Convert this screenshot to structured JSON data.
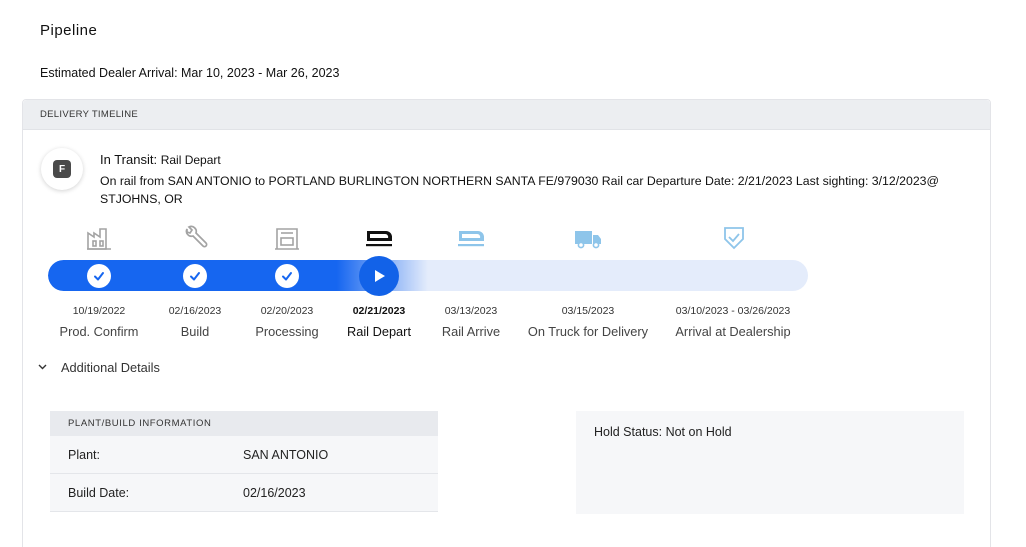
{
  "page": {
    "title": "Pipeline",
    "eta": "Estimated Dealer Arrival: Mar 10, 2023 - Mar 26, 2023"
  },
  "timeline": {
    "header": "DELIVERY TIMELINE",
    "badge_letter": "F",
    "status_main": "In Transit:",
    "status_sub": "Rail Depart",
    "description": "On rail from SAN ANTONIO to PORTLAND BURLINGTON NORTHERN SANTA FE/979030 Rail car Departure Date: 2/21/2023 Last sighting: 3/12/2023@ STJOHNS, OR",
    "progress_fraction": 0.5,
    "stages": [
      {
        "date": "10/19/2022",
        "label": "Prod. Confirm",
        "state": "done",
        "icon": "factory-icon"
      },
      {
        "date": "02/16/2023",
        "label": "Build",
        "state": "done",
        "icon": "wrench-icon"
      },
      {
        "date": "02/20/2023",
        "label": "Processing",
        "state": "done",
        "icon": "processing-icon"
      },
      {
        "date": "02/21/2023",
        "label": "Rail Depart",
        "state": "current",
        "icon": "rail-icon"
      },
      {
        "date": "03/13/2023",
        "label": "Rail Arrive",
        "state": "pending",
        "icon": "rail-arrive-icon"
      },
      {
        "date": "03/15/2023",
        "label": "On Truck for Delivery",
        "state": "pending",
        "icon": "truck-icon"
      },
      {
        "date": "03/10/2023 - 03/26/2023",
        "label": "Arrival at Dealership",
        "state": "pending",
        "icon": "shield-check-icon"
      }
    ],
    "colors": {
      "done_icon": "#a3a3a3",
      "current_icon": "#111111",
      "pending_icon": "#8ec5ea",
      "progress": "#1666f0",
      "track": "#e4ecfb"
    }
  },
  "details": {
    "toggle_label": "Additional Details",
    "plant_header": "PLANT/BUILD INFORMATION",
    "rows": [
      {
        "key": "Plant:",
        "value": "SAN ANTONIO"
      },
      {
        "key": "Build Date:",
        "value": "02/16/2023"
      }
    ],
    "hold_status": "Hold Status: Not on Hold"
  }
}
